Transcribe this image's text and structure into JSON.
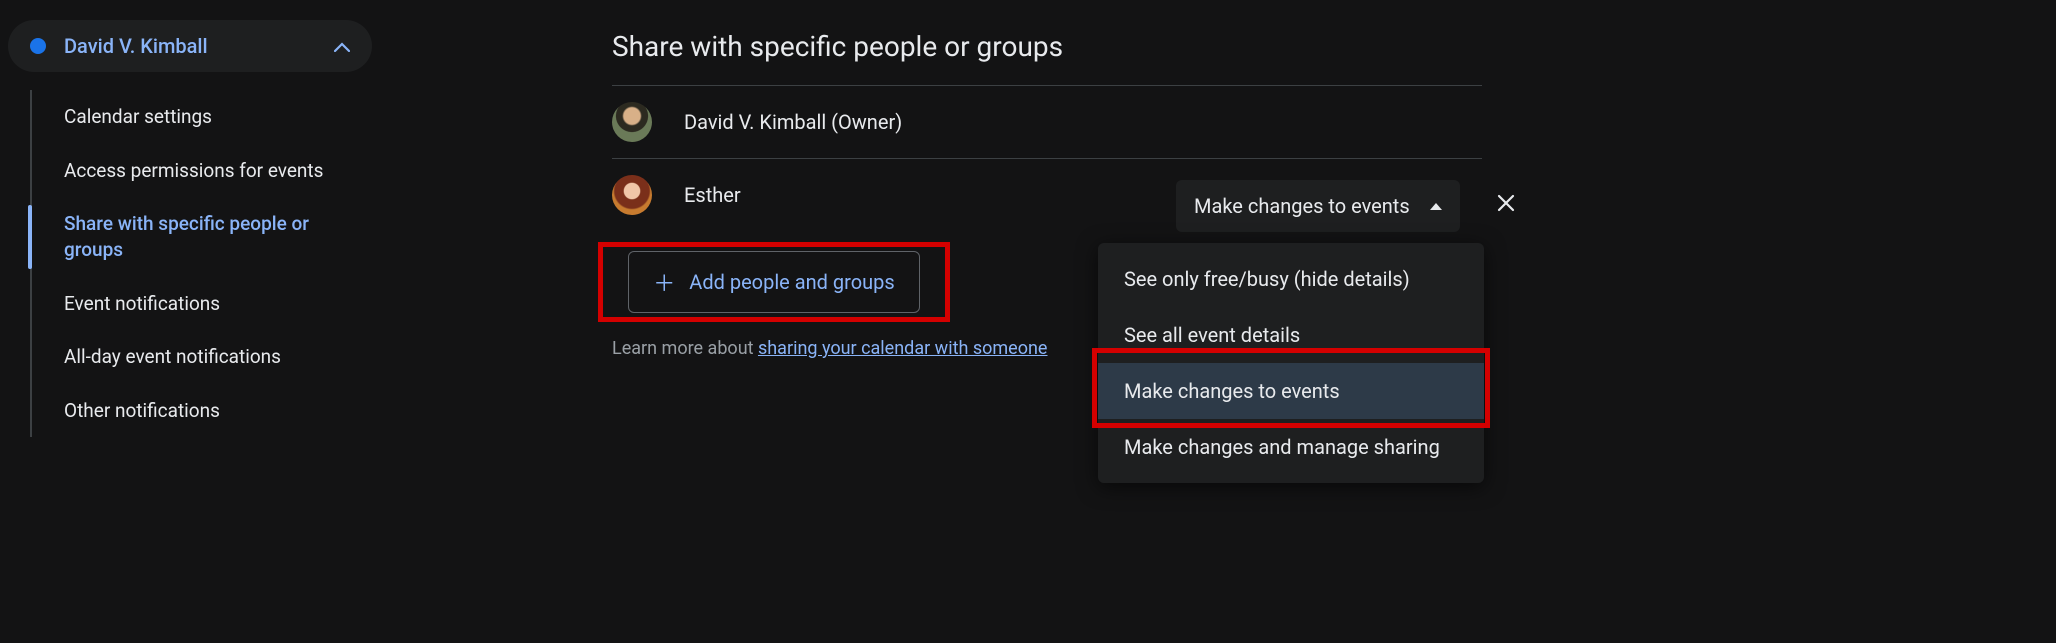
{
  "sidebar": {
    "calendar_name": "David V. Kimball",
    "items": [
      {
        "label": "Calendar settings"
      },
      {
        "label": "Access permissions for events"
      },
      {
        "label": "Share with specific people or groups"
      },
      {
        "label": "Event notifications"
      },
      {
        "label": "All-day event notifications"
      },
      {
        "label": "Other notifications"
      }
    ]
  },
  "main": {
    "section_title": "Share with specific people or groups",
    "people": [
      {
        "name": "David V. Kimball (Owner)"
      },
      {
        "name": "Esther"
      }
    ],
    "permission_selected": "Make changes to events",
    "add_button": "Add people and groups",
    "learn_prefix": "Learn more about ",
    "learn_link": "sharing your calendar with someone"
  },
  "permission_menu": [
    "See only free/busy (hide details)",
    "See all event details",
    "Make changes to events",
    "Make changes and manage sharing"
  ]
}
